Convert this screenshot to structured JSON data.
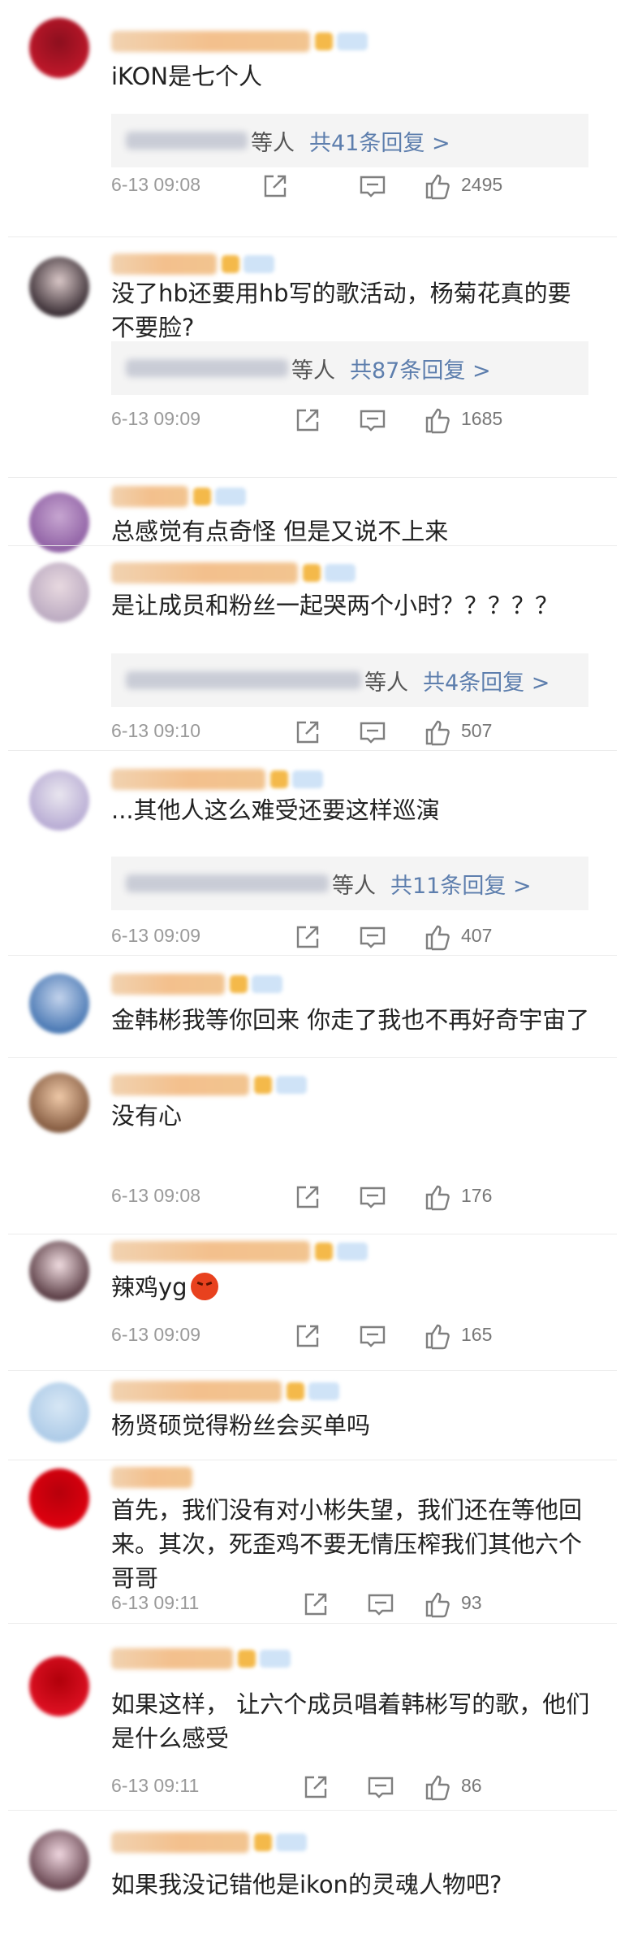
{
  "comments": [
    {
      "text": "iKON是七个人",
      "replies": {
        "who": "等人",
        "count": "共41条回复 >"
      },
      "time": "6-13 09:08",
      "likes": "2495"
    },
    {
      "text": "没了hb还要用hb写的歌活动，杨菊花真的要不要脸?",
      "replies": {
        "who": "等人",
        "count": "共87条回复 >"
      },
      "time": "6-13 09:09",
      "likes": "1685"
    },
    {
      "text": "总感觉有点奇怪  但是又说不上来"
    },
    {
      "text": "是让成员和粉丝一起哭两个小时？？？？？",
      "replies": {
        "who": "等人",
        "count": "共4条回复 >"
      },
      "time": "6-13 09:10",
      "likes": "507"
    },
    {
      "text": "...其他人这么难受还要这样巡演",
      "replies": {
        "who": "等人",
        "count": "共11条回复 >"
      },
      "time": "6-13 09:09",
      "likes": "407"
    },
    {
      "text": "金韩彬我等你回来 你走了我也不再好奇宇宙了"
    },
    {
      "text": "没有心",
      "time": "6-13 09:08",
      "likes": "176"
    },
    {
      "text": "辣鸡yg",
      "emoji": "angry-face-emoji",
      "time": "6-13 09:09",
      "likes": "165"
    },
    {
      "text": "杨贤硕觉得粉丝会买单吗"
    },
    {
      "text": "首先，我们没有对小彬失望，我们还在等他回来。其次，死歪鸡不要无情压榨我们其他六个哥哥",
      "time": "6-13 09:11",
      "likes": "93"
    },
    {
      "text": "如果这样， 让六个成员唱着韩彬写的歌，他们是什么感受",
      "time": "6-13 09:11",
      "likes": "86"
    },
    {
      "text": "如果我没记错他是ikon的灵魂人物吧?"
    }
  ],
  "colors": {
    "link": "#5d7ead",
    "time": "#9a9a9a",
    "icon": "#7f7f7f"
  }
}
